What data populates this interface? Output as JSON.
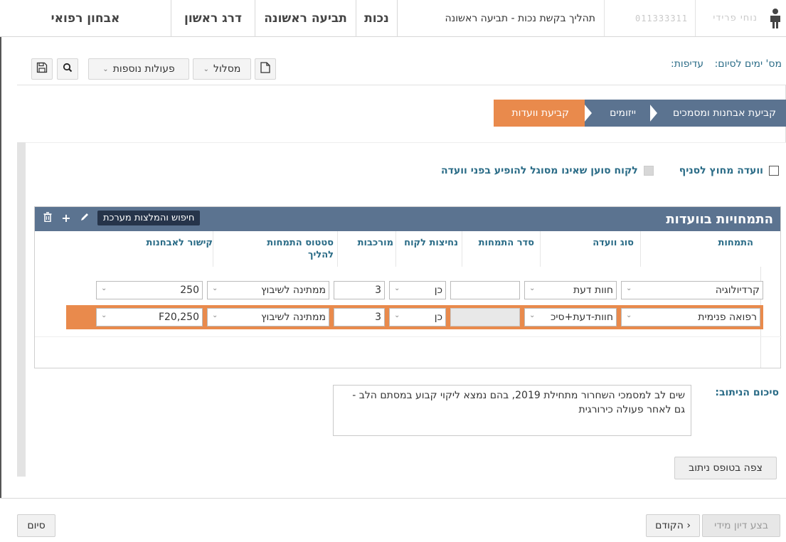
{
  "header": {
    "person_name_masked": "נוחי פרידי",
    "id_masked": "011333311",
    "process_title": "תהליך בקשת נכות - תביעה ראשונה",
    "tabs": [
      {
        "label": "נכות"
      },
      {
        "label": "תביעה ראשונה"
      },
      {
        "label": "דרג ראשון"
      },
      {
        "label": "אבחון רפואי"
      }
    ]
  },
  "infobar": {
    "days_label": "מס' ימים לסיום:",
    "priority_label": "עדיפות:",
    "toolbar": {
      "route_label": "מסלול",
      "more_actions_label": "פעולות נוספות"
    }
  },
  "steps": [
    {
      "label": "קביעת אבחנות ומסמכים"
    },
    {
      "label": "ייזומים"
    },
    {
      "label": "קביעת וועדות"
    }
  ],
  "checkboxes": {
    "outside_branch": "וועדה מחוץ לסניף",
    "customer_unfit": "לקוח סוען שאינו מסוגל להופיע בפני וועדה"
  },
  "table": {
    "title": "התמחויות בוועדות",
    "search_tag": "חיפוש והמלצות מערכת",
    "columns": [
      "התמחות",
      "סוג וועדה",
      "סדר התמחות",
      "נחיצות לקוח",
      "מורכבות",
      "סטטוס התמחות להליך",
      "קישור לאבחנות"
    ],
    "rows": [
      {
        "specialty": "קרדיולוגיה",
        "committee_type": "חוות דעת",
        "order": "",
        "necessity": "כן",
        "complexity": "3",
        "status": "ממתינה לשיבוץ",
        "diagnosis_link": "250"
      },
      {
        "specialty": "רפואה פנימית",
        "committee_type": "חוות-דעת+סיכ",
        "order": "",
        "necessity": "כן",
        "complexity": "3",
        "status": "ממתינה לשיבוץ",
        "diagnosis_link": "F20,250"
      }
    ]
  },
  "summary": {
    "label": "סיכום הניתוב:",
    "text": "שים לב למסמכי השחרור מתחילת 2019, בהם נמצא ליקוי קבוע במסתם הלב - גם לאחר פעולה כירורגית",
    "view_form_button": "צפה בטופס ניתוב"
  },
  "footer": {
    "immediate_button": "בצע דיון מידי",
    "prev_button": "‹ הקודם",
    "end_button": "סיום"
  },
  "colors": {
    "accent_orange": "#e98a4c",
    "step_blue": "#5b7390",
    "label_teal": "#2b6c87"
  }
}
